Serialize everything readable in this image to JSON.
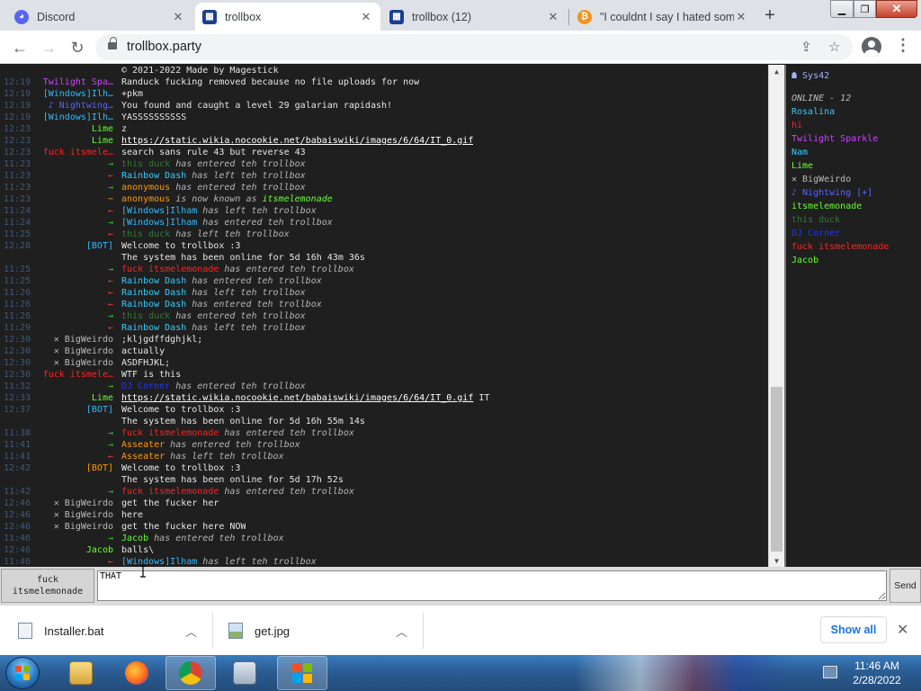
{
  "browser": {
    "tabs": [
      {
        "title": "Discord",
        "icon": "discord-icon",
        "color": "#5865f2",
        "active": false
      },
      {
        "title": "trollbox",
        "icon": "trollbox-favicon",
        "color": "#1b3f8f",
        "active": true
      },
      {
        "title": "trollbox (12)",
        "icon": "trollbox-favicon",
        "color": "#1b3f8f",
        "active": false
      },
      {
        "title": "\"I couldnt I say I hated som",
        "icon": "bitcoin-favicon",
        "color": "#f7931a",
        "active": false
      }
    ],
    "url": "trollbox.party"
  },
  "chat": {
    "rows": [
      {
        "time": "",
        "nick": "",
        "nick_color": "#ffffff",
        "msg": "© 2021-2022 Made by Magestick",
        "kind": "text"
      },
      {
        "time": "12:19",
        "nick": "Twilight Spa…",
        "nick_color": "#cc44ff",
        "msg": "Randuck fucking removed because no file uploads for now",
        "kind": "text"
      },
      {
        "time": "12:19",
        "nick": "[Windows]Ilh…",
        "nick_color": "#33bbff",
        "msg": "+pkm",
        "kind": "text"
      },
      {
        "time": "12:19",
        "nick": "♪ Nightwing…",
        "nick_color": "#5566ff",
        "msg": "You found and caught a level 29 galarian rapidash!",
        "kind": "text"
      },
      {
        "time": "12:19",
        "nick": "[Windows]Ilh…",
        "nick_color": "#33bbff",
        "msg": "YASSSSSSSSSS",
        "kind": "text"
      },
      {
        "time": "12:23",
        "nick": "Lime",
        "nick_color": "#66ff33",
        "msg": "z",
        "kind": "text"
      },
      {
        "time": "12:23",
        "nick": "Lime",
        "nick_color": "#66ff33",
        "msg": "https://static.wikia.nocookie.net/babaiswiki/images/6/64/IT_0.gif",
        "kind": "link"
      },
      {
        "time": "12:23",
        "nick": "fuck itsmele…",
        "nick_color": "#ff2222",
        "msg": "search sans rule 43 but reverse 43",
        "kind": "text"
      },
      {
        "time": "11:23",
        "nick": "→",
        "nick_color": "#33cc33",
        "evt_nick": "this duck",
        "evt_color": "#2e7d32",
        "msg": "has entered teh trollbox",
        "kind": "event"
      },
      {
        "time": "11:23",
        "nick": "←",
        "nick_color": "#ff3333",
        "evt_nick": "Rainbow Dash",
        "evt_color": "#33ccff",
        "msg": "has left teh trollbox",
        "kind": "event"
      },
      {
        "time": "11:23",
        "nick": "→",
        "nick_color": "#33cc33",
        "evt_nick": "anonymous",
        "evt_color": "#ff9900",
        "msg": "has entered teh trollbox",
        "kind": "event"
      },
      {
        "time": "11:23",
        "nick": "~",
        "nick_color": "#ff9900",
        "evt_nick": "anonymous",
        "evt_color": "#ff9900",
        "msg": "is now known as itsmelemonade",
        "evt_tail": "itsmelemonade",
        "kind": "rename"
      },
      {
        "time": "11:24",
        "nick": "←",
        "nick_color": "#ff3333",
        "evt_nick": "[Windows]Ilham",
        "evt_color": "#33bbff",
        "msg": "has left teh trollbox",
        "kind": "event"
      },
      {
        "time": "11:24",
        "nick": "→",
        "nick_color": "#33cc33",
        "evt_nick": "[Windows]Ilham",
        "evt_color": "#33bbff",
        "msg": "has entered teh trollbox",
        "kind": "event"
      },
      {
        "time": "11:25",
        "nick": "←",
        "nick_color": "#ff3333",
        "evt_nick": "this duck",
        "evt_color": "#2e7d32",
        "msg": "has left teh trollbox",
        "kind": "event"
      },
      {
        "time": "12:28",
        "nick": "[BOT]",
        "nick_color": "#33bbff",
        "msg": "Welcome to trollbox :3",
        "kind": "text"
      },
      {
        "time": "",
        "nick": "",
        "nick_color": "#ffffff",
        "msg": "The system has been online for 5d 16h 43m 36s",
        "kind": "text"
      },
      {
        "time": "11:25",
        "nick": "→",
        "nick_color": "#33cc33",
        "evt_nick": "fuck itsmelemonade",
        "evt_color": "#ff2222",
        "msg": "has entered teh trollbox",
        "kind": "event"
      },
      {
        "time": "11:25",
        "nick": "←",
        "nick_color": "#ff3333",
        "evt_nick": "Rainbow Dash",
        "evt_color": "#33ccff",
        "msg": "has entered teh trollbox",
        "kind": "event"
      },
      {
        "time": "11:26",
        "nick": "←",
        "nick_color": "#ff3333",
        "evt_nick": "Rainbow Dash",
        "evt_color": "#33ccff",
        "msg": "has left teh trollbox",
        "kind": "event"
      },
      {
        "time": "11:26",
        "nick": "←",
        "nick_color": "#ff3333",
        "evt_nick": "Rainbow Dash",
        "evt_color": "#33ccff",
        "msg": "has entered teh trollbox",
        "kind": "event"
      },
      {
        "time": "11:26",
        "nick": "→",
        "nick_color": "#33cc33",
        "evt_nick": "this duck",
        "evt_color": "#2e7d32",
        "msg": "has entered teh trollbox",
        "kind": "event"
      },
      {
        "time": "11:29",
        "nick": "←",
        "nick_color": "#ff3333",
        "evt_nick": "Rainbow Dash",
        "evt_color": "#33ccff",
        "msg": "has left teh trollbox",
        "kind": "event"
      },
      {
        "time": "12:30",
        "nick": "✕ BigWeirdo",
        "nick_color": "#bbbbbb",
        "msg": ";kljgdffdghjkl;",
        "kind": "text"
      },
      {
        "time": "12:30",
        "nick": "✕ BigWeirdo",
        "nick_color": "#bbbbbb",
        "msg": "actually",
        "kind": "text"
      },
      {
        "time": "12:30",
        "nick": "✕ BigWeirdo",
        "nick_color": "#bbbbbb",
        "msg": "ASDFHJKL;",
        "kind": "text"
      },
      {
        "time": "12:30",
        "nick": "fuck itsmele…",
        "nick_color": "#ff2222",
        "msg": "WTF is this",
        "kind": "text"
      },
      {
        "time": "11:32",
        "nick": "→",
        "nick_color": "#33cc33",
        "evt_nick": "DJ Corner",
        "evt_color": "#2233ff",
        "msg": "has entered teh trollbox",
        "kind": "event"
      },
      {
        "time": "12:33",
        "nick": "Lime",
        "nick_color": "#66ff33",
        "msg": "https://static.wikia.nocookie.net/babaiswiki/images/6/64/IT_0.gif",
        "msg_tail": "IT",
        "kind": "link"
      },
      {
        "time": "12:37",
        "nick": "[BOT]",
        "nick_color": "#33bbff",
        "msg": "Welcome to trollbox :3",
        "kind": "text"
      },
      {
        "time": "",
        "nick": "",
        "nick_color": "#ffffff",
        "msg": "The system has been online for 5d 16h 55m 14s",
        "kind": "text"
      },
      {
        "time": "11:38",
        "nick": "→",
        "nick_color": "#33cc33",
        "evt_nick": "fuck itsmelemonade",
        "evt_color": "#ff2222",
        "msg": "has entered teh trollbox",
        "kind": "event"
      },
      {
        "time": "11:41",
        "nick": "→",
        "nick_color": "#33cc33",
        "evt_nick": "Asseater",
        "evt_color": "#ff9900",
        "msg": "has entered teh trollbox",
        "kind": "event"
      },
      {
        "time": "11:41",
        "nick": "←",
        "nick_color": "#ff3333",
        "evt_nick": "Asseater",
        "evt_color": "#ff9900",
        "msg": "has left teh trollbox",
        "kind": "event"
      },
      {
        "time": "12:42",
        "nick": "[BOT]",
        "nick_color": "#ff9900",
        "msg": "Welcome to trollbox :3",
        "kind": "text"
      },
      {
        "time": "",
        "nick": "",
        "nick_color": "#ffffff",
        "msg": "The system has been online for 5d 17h 52s",
        "kind": "text"
      },
      {
        "time": "11:42",
        "nick": "→",
        "nick_color": "#33cc33",
        "evt_nick": "fuck itsmelemonade",
        "evt_color": "#ff2222",
        "msg": "has entered teh trollbox",
        "kind": "event"
      },
      {
        "time": "12:46",
        "nick": "✕ BigWeirdo",
        "nick_color": "#bbbbbb",
        "msg": "get the fucker her",
        "kind": "text"
      },
      {
        "time": "12:46",
        "nick": "✕ BigWeirdo",
        "nick_color": "#bbbbbb",
        "msg": "here",
        "kind": "text"
      },
      {
        "time": "12:46",
        "nick": "✕ BigWeirdo",
        "nick_color": "#bbbbbb",
        "msg": "get the fucker here NOW",
        "kind": "text"
      },
      {
        "time": "11:46",
        "nick": "→",
        "nick_color": "#33cc33",
        "evt_nick": "Jacob",
        "evt_color": "#66ff33",
        "msg": "has entered teh trollbox",
        "kind": "event"
      },
      {
        "time": "12:46",
        "nick": "Jacob",
        "nick_color": "#66ff33",
        "msg": "balls\\",
        "kind": "text"
      },
      {
        "time": "11:46",
        "nick": "←",
        "nick_color": "#ff3333",
        "evt_nick": "[Windows]Ilham",
        "evt_color": "#33bbff",
        "msg": "has left teh trollbox",
        "kind": "event"
      }
    ]
  },
  "sidebar": {
    "current_user": "☗ Sys42",
    "current_user_color": "#a0b4ff",
    "online_label": "ONLINE - 12",
    "users": [
      {
        "name": "Rosalina",
        "color": "#33ccff"
      },
      {
        "name": "hi",
        "color": "#ff2222"
      },
      {
        "name": "Twilight Sparkle",
        "color": "#cc44ff"
      },
      {
        "name": "Nam",
        "color": "#33ccff"
      },
      {
        "name": "Lime",
        "color": "#66ff33"
      },
      {
        "name": "✕ BigWeirdo",
        "color": "#bbbbbb"
      },
      {
        "name": "♪ Nightwing [+]",
        "color": "#5566ff"
      },
      {
        "name": "itsmelemonade",
        "color": "#66ff33"
      },
      {
        "name": "this duck",
        "color": "#2e7d32"
      },
      {
        "name": "DJ Corner",
        "color": "#2233ff"
      },
      {
        "name": "fuck itsmelemonade",
        "color": "#ff2222"
      },
      {
        "name": "Jacob",
        "color": "#66ff33"
      }
    ]
  },
  "input": {
    "nick_line1": "fuck",
    "nick_line2": "itsmelemonade",
    "value": "THAT",
    "send_label": "Send"
  },
  "downloads": {
    "items": [
      {
        "name": "Installer.bat",
        "icon": "batch-file-icon"
      },
      {
        "name": "get.jpg",
        "icon": "image-file-icon"
      }
    ],
    "show_all_label": "Show all"
  },
  "taskbar": {
    "time": "11:46 AM",
    "date": "2/28/2022"
  },
  "colors": {
    "chat_bg": "#1f1f1f",
    "timestamp": "#3f5a79",
    "message_text": "#e6e6e6",
    "accent_link": "#1a73e8"
  }
}
